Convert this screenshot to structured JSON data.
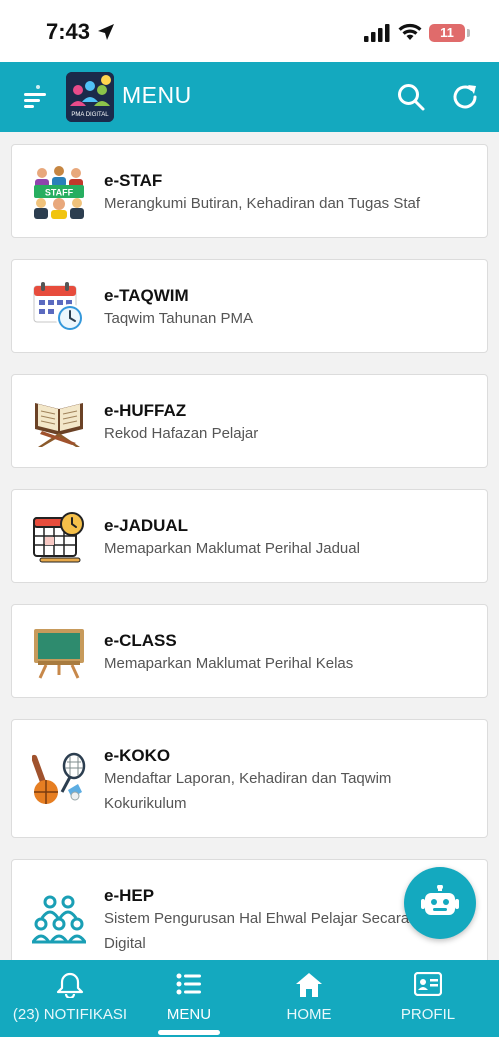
{
  "status_bar": {
    "time": "7:43",
    "battery": "11"
  },
  "header": {
    "title": "MENU",
    "logo_text": "PMA DIGITAL"
  },
  "menu": {
    "items": [
      {
        "title": "e-STAF",
        "subtitle": "Merangkumi Butiran, Kehadiran dan Tugas Staf",
        "icon": "staff-icon",
        "badge": "STAFF"
      },
      {
        "title": "e-TAQWIM",
        "subtitle": "Taqwim Tahunan PMA",
        "icon": "calendar-clock-icon"
      },
      {
        "title": "e-HUFFAZ",
        "subtitle": "Rekod Hafazan Pelajar",
        "icon": "quran-book-icon"
      },
      {
        "title": "e-JADUAL",
        "subtitle": "Memaparkan Maklumat Perihal Jadual",
        "icon": "timetable-icon"
      },
      {
        "title": "e-CLASS",
        "subtitle": "Memaparkan Maklumat Perihal Kelas",
        "icon": "chalkboard-icon"
      },
      {
        "title": "e-KOKO",
        "subtitle": "Mendaftar Laporan, Kehadiran dan Taqwim Kokurikulum",
        "icon": "sports-icon"
      },
      {
        "title": "e-HEP",
        "subtitle": "Sistem Pengurusan Hal Ehwal Pelajar Secara Digital",
        "icon": "students-group-icon"
      }
    ]
  },
  "bottom_nav": {
    "items": [
      {
        "label": "(23) NOTIFIKASI",
        "icon": "bell-icon"
      },
      {
        "label": "MENU",
        "icon": "list-icon",
        "active": true
      },
      {
        "label": "HOME",
        "icon": "home-icon"
      },
      {
        "label": "PROFIL",
        "icon": "id-card-icon"
      }
    ]
  },
  "colors": {
    "primary": "#14a9bf",
    "card_bg": "#ffffff",
    "page_bg": "#f2f2f2"
  }
}
